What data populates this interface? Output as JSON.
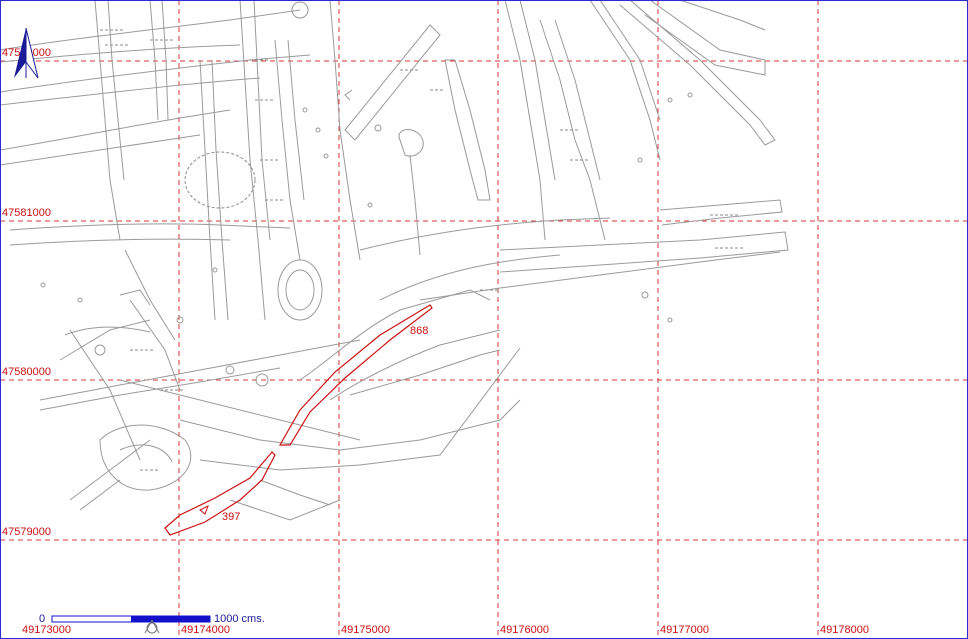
{
  "grid": {
    "x_labels": [
      "49173000",
      "49174000",
      "49175000",
      "49176000",
      "49177000",
      "49178000"
    ],
    "y_labels": [
      "47582000",
      "47581000",
      "47580000",
      "47579000"
    ],
    "line_color": "#d43a3a",
    "label_color": "#cc1111"
  },
  "highlight": {
    "color": "#cc1111",
    "labels": [
      "868",
      "397"
    ]
  },
  "scale_bar": {
    "start_label": "0",
    "end_label": "1000",
    "units": "cms.",
    "color": "#1111cc"
  },
  "north_arrow": {
    "icon": "north-arrow-icon",
    "color": "#1a1a99"
  },
  "workings_color": "#9a9a9a",
  "frame_color": "#2b2bd6"
}
